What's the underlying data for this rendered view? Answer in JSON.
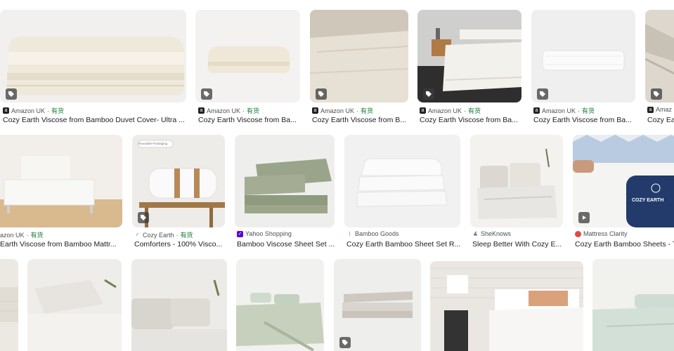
{
  "colors": {
    "stock": "#188038",
    "source": "#4d5156",
    "title": "#202124"
  },
  "row1": [
    {
      "source": "Amazon UK",
      "sep": " · ",
      "stock": "有货",
      "title": "Cozy Earth Viscose from Bamboo Duvet Cover- Ultra ...",
      "favicon": "amazon-icon",
      "badge": "tag-icon"
    },
    {
      "source": "Amazon UK",
      "sep": " · ",
      "stock": "有货",
      "title": "Cozy Earth Viscose from Ba...",
      "favicon": "amazon-icon",
      "badge": "tag-icon"
    },
    {
      "source": "Amazon UK",
      "sep": " · ",
      "stock": "有货",
      "title": "Cozy Earth Viscose from B...",
      "favicon": "amazon-icon",
      "badge": "tag-icon"
    },
    {
      "source": "Amazon UK",
      "sep": " · ",
      "stock": "有货",
      "title": "Cozy Earth Viscose from Ba...",
      "favicon": "amazon-icon",
      "badge": "tag-icon"
    },
    {
      "source": "Amazon UK",
      "sep": " · ",
      "stock": "有货",
      "title": "Cozy Earth Viscose from Ba...",
      "favicon": "amazon-icon",
      "badge": "tag-icon"
    },
    {
      "source": "Amaz",
      "sep": "",
      "stock": "",
      "title": "Cozy Ea",
      "favicon": "amazon-icon",
      "badge": "tag-icon"
    }
  ],
  "row2": [
    {
      "source": "azon UK",
      "sep": " · ",
      "stock": "有货",
      "title": "Earth Viscose from Bamboo Mattr...",
      "favicon": "",
      "badge": ""
    },
    {
      "source": "Cozy Earth",
      "sep": " · ",
      "stock": "有货",
      "title": "Comforters - 100% Visco...",
      "favicon": "cozy-earth-icon",
      "badge": "tag-icon",
      "overlay": "Reusable Packaging"
    },
    {
      "source": "Yahoo Shopping",
      "sep": "",
      "stock": "",
      "title": "Bamboo Viscose Sheet Set ...",
      "favicon": "yahoo-icon",
      "badge": ""
    },
    {
      "source": "Bamboo Goods",
      "sep": "",
      "stock": "",
      "title": "Cozy Earth Bamboo Sheet Set R...",
      "favicon": "bamboo-goods-icon",
      "badge": ""
    },
    {
      "source": "SheKnows",
      "sep": "",
      "stock": "",
      "title": "Sleep Better With Cozy E...",
      "favicon": "sheknows-icon",
      "badge": ""
    },
    {
      "source": "Mattress Clarity",
      "sep": "",
      "stock": "",
      "title": "Cozy Earth Bamboo Sheets - T",
      "favicon": "mattress-clarity-icon",
      "badge": "play-icon",
      "overlay": "COZY EARTH"
    }
  ]
}
